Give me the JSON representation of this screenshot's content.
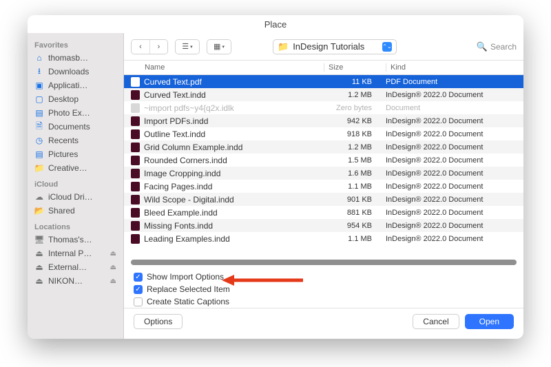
{
  "title": "Place",
  "sidebar": {
    "sections": [
      {
        "label": "Favorites",
        "items": [
          {
            "icon": "home",
            "label": "thomasb…"
          },
          {
            "icon": "download",
            "label": "Downloads"
          },
          {
            "icon": "app",
            "label": "Applicati…"
          },
          {
            "icon": "desktop",
            "label": "Desktop"
          },
          {
            "icon": "photo",
            "label": "Photo Ex…"
          },
          {
            "icon": "doc",
            "label": "Documents"
          },
          {
            "icon": "clock",
            "label": "Recents"
          },
          {
            "icon": "photo",
            "label": "Pictures"
          },
          {
            "icon": "folder",
            "label": "Creative…"
          }
        ]
      },
      {
        "label": "iCloud",
        "items": [
          {
            "icon": "cloud",
            "label": "iCloud Dri…"
          },
          {
            "icon": "shared",
            "label": "Shared"
          }
        ]
      },
      {
        "label": "Locations",
        "items": [
          {
            "icon": "mac",
            "label": "Thomas's…"
          },
          {
            "icon": "disk",
            "label": "Internal P…",
            "eject": true
          },
          {
            "icon": "disk",
            "label": "External…",
            "eject": true
          },
          {
            "icon": "disk",
            "label": "NIKON…",
            "eject": true
          }
        ]
      }
    ]
  },
  "toolbar": {
    "path": "InDesign Tutorials",
    "search_placeholder": "Search"
  },
  "columns": {
    "c1": "Name",
    "c2": "Size",
    "c3": "Kind"
  },
  "files": [
    {
      "name": "Curved Text.pdf",
      "size": "11 KB",
      "kind": "PDF Document",
      "type": "pdf",
      "selected": true
    },
    {
      "name": "Curved Text.indd",
      "size": "1.2 MB",
      "kind": "InDesign® 2022.0 Document",
      "type": "indd"
    },
    {
      "name": "~import pdfs~y4{q2x.idlk",
      "size": "Zero bytes",
      "kind": "Document",
      "type": "dim",
      "dim": true
    },
    {
      "name": "Import PDFs.indd",
      "size": "942 KB",
      "kind": "InDesign® 2022.0 Document",
      "type": "indd"
    },
    {
      "name": "Outline Text.indd",
      "size": "918 KB",
      "kind": "InDesign® 2022.0 Document",
      "type": "indd"
    },
    {
      "name": "Grid Column Example.indd",
      "size": "1.2 MB",
      "kind": "InDesign® 2022.0 Document",
      "type": "indd"
    },
    {
      "name": "Rounded Corners.indd",
      "size": "1.5 MB",
      "kind": "InDesign® 2022.0 Document",
      "type": "indd"
    },
    {
      "name": "Image Cropping.indd",
      "size": "1.6 MB",
      "kind": "InDesign® 2022.0 Document",
      "type": "indd"
    },
    {
      "name": "Facing Pages.indd",
      "size": "1.1 MB",
      "kind": "InDesign® 2022.0 Document",
      "type": "indd"
    },
    {
      "name": "Wild Scope - Digital.indd",
      "size": "901 KB",
      "kind": "InDesign® 2022.0 Document",
      "type": "indd"
    },
    {
      "name": "Bleed Example.indd",
      "size": "881 KB",
      "kind": "InDesign® 2022.0 Document",
      "type": "indd"
    },
    {
      "name": "Missing Fonts.indd",
      "size": "954 KB",
      "kind": "InDesign® 2022.0 Document",
      "type": "indd"
    },
    {
      "name": "Leading Examples.indd",
      "size": "1.1 MB",
      "kind": "InDesign® 2022.0 Document",
      "type": "indd"
    }
  ],
  "options": {
    "show_import": {
      "label": "Show Import Options",
      "checked": true
    },
    "replace_sel": {
      "label": "Replace Selected Item",
      "checked": true
    },
    "static_cap": {
      "label": "Create Static Captions",
      "checked": false
    }
  },
  "buttons": {
    "options": "Options",
    "cancel": "Cancel",
    "open": "Open"
  }
}
